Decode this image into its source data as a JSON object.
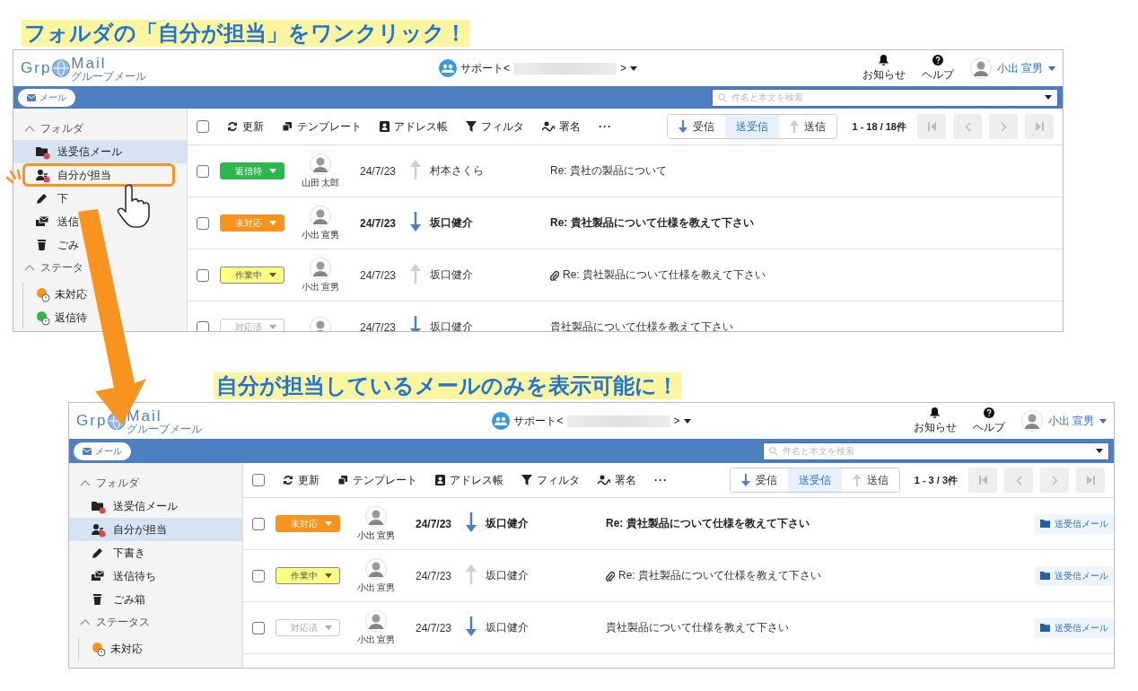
{
  "panels": [
    {
      "caption": "フォルダの「自分が担当」をワンクリック！",
      "screen": {
        "logo": {
          "word_1": "Grp",
          "word_2": "Mail",
          "tagline": "グループメール"
        },
        "account": {
          "prefix": "サポート<",
          "suffix": ">"
        },
        "header_actions": [
          {
            "label": "お知らせ",
            "kind": "bell"
          },
          {
            "label": "ヘルプ",
            "kind": "help"
          }
        ],
        "user": {
          "name": "小出 宣男"
        },
        "app_tab": {
          "label": "メール"
        },
        "search": {
          "placeholder": "件名と本文を検索"
        },
        "select_all": {
          "checked": false
        },
        "toolbar": [
          {
            "label": "更新",
            "kind": "refresh"
          },
          {
            "label": "テンプレート",
            "kind": "template"
          },
          {
            "label": "アドレス帳",
            "kind": "contacts"
          },
          {
            "label": "フィルタ",
            "kind": "filter"
          },
          {
            "label": "署名",
            "kind": "signature"
          },
          {
            "label": "···",
            "kind": "more"
          }
        ],
        "direction_filter": [
          {
            "label": "受信",
            "kind": "in",
            "selected": false
          },
          {
            "label": "送受信",
            "kind": "both",
            "selected": true
          },
          {
            "label": "送信",
            "kind": "out",
            "selected": false
          }
        ],
        "page_count": "1 - 18 / 18件",
        "sidebar": {
          "folders_header": "フォルダ",
          "folders": [
            {
              "label": "送受信メール",
              "kind": "folder",
              "alert": true,
              "selected": true,
              "highlighted": false
            },
            {
              "label": "自分が担当",
              "kind": "person",
              "alert": true,
              "selected": false,
              "highlighted": true
            },
            {
              "label": "下",
              "kind": "pencil",
              "alert": false,
              "selected": false,
              "highlighted": false
            },
            {
              "label": "送信",
              "kind": "outbox",
              "alert": false,
              "selected": false,
              "highlighted": false
            },
            {
              "label": "ごみ",
              "kind": "trash",
              "alert": false,
              "selected": false,
              "highlighted": false
            }
          ],
          "status_header": "ステータ",
          "statuses": [
            {
              "label": "未対応",
              "color": "#f7931e"
            },
            {
              "label": "返信待",
              "color": "#2db84d"
            }
          ]
        },
        "rows": [
          {
            "checked": false,
            "status": {
              "label": "返信待",
              "color": "#2db84d"
            },
            "assignee": "山田 太郎",
            "date": "24/7/23",
            "incoming": false,
            "sender": "村本さくら",
            "subject": "Re: 貴社の製品について",
            "unread": false,
            "attachment": false
          },
          {
            "checked": false,
            "status": {
              "label": "未対応",
              "color": "#f7931e"
            },
            "assignee": "小出 宣男",
            "date": "24/7/23",
            "incoming": true,
            "sender": "坂口健介",
            "subject": "Re: 貴社製品について仕様を教えて下さい",
            "unread": true,
            "attachment": false
          },
          {
            "checked": false,
            "status": {
              "label": "作業中",
              "color": "#ffff80"
            },
            "assignee": "小出 宣男",
            "date": "24/7/23",
            "incoming": false,
            "sender": "坂口健介",
            "subject": "Re: 貴社製品について仕様を教えて下さい",
            "unread": false,
            "attachment": true
          },
          {
            "checked": false,
            "status": {
              "label": "対応済",
              "color": "#ffffff"
            },
            "date": "24/7/23",
            "incoming": true,
            "sender": "坂口健介",
            "subject": "貴社製品について仕様を教えて下さい",
            "unread": false,
            "attachment": false
          }
        ]
      }
    },
    {
      "caption": "自分が担当しているメールのみを表示可能に！",
      "screen": {
        "logo": {
          "word_1": "Grp",
          "word_2": "Mail",
          "tagline": "グループメール"
        },
        "account": {
          "prefix": "サポート<",
          "suffix": ">"
        },
        "header_actions": [
          {
            "label": "お知らせ",
            "kind": "bell"
          },
          {
            "label": "ヘルプ",
            "kind": "help"
          }
        ],
        "user": {
          "name": "小出 宣男"
        },
        "app_tab": {
          "label": "メール"
        },
        "search": {
          "placeholder": "件名と本文を検索"
        },
        "select_all": {
          "checked": false
        },
        "toolbar": [
          {
            "label": "更新",
            "kind": "refresh"
          },
          {
            "label": "テンプレート",
            "kind": "template"
          },
          {
            "label": "アドレス帳",
            "kind": "contacts"
          },
          {
            "label": "フィルタ",
            "kind": "filter"
          },
          {
            "label": "署名",
            "kind": "signature"
          },
          {
            "label": "···",
            "kind": "more"
          }
        ],
        "direction_filter": [
          {
            "label": "受信",
            "kind": "in",
            "selected": false
          },
          {
            "label": "送受信",
            "kind": "both",
            "selected": true
          },
          {
            "label": "送信",
            "kind": "out",
            "selected": false
          }
        ],
        "page_count": "1 - 3 / 3件",
        "sidebar": {
          "folders_header": "フォルダ",
          "folders": [
            {
              "label": "送受信メール",
              "kind": "folder",
              "alert": true,
              "selected": false,
              "highlighted": false
            },
            {
              "label": "自分が担当",
              "kind": "person",
              "alert": true,
              "selected": true,
              "highlighted": false
            },
            {
              "label": "下書き",
              "kind": "pencil",
              "alert": false,
              "selected": false,
              "highlighted": false
            },
            {
              "label": "送信待ち",
              "kind": "outbox",
              "alert": false,
              "selected": false,
              "highlighted": false
            },
            {
              "label": "ごみ箱",
              "kind": "trash",
              "alert": false,
              "selected": false,
              "highlighted": false
            }
          ],
          "status_header": "ステータス",
          "statuses": [
            {
              "label": "未対応",
              "color": "#f7931e"
            }
          ]
        },
        "rows": [
          {
            "checked": false,
            "status": {
              "label": "未対応",
              "color": "#f7931e"
            },
            "assignee": "小出 宣男",
            "date": "24/7/23",
            "incoming": true,
            "sender": "坂口健介",
            "subject": "Re: 貴社製品について仕様を教えて下さい",
            "unread": true,
            "attachment": false,
            "folder": "送受信メール"
          },
          {
            "checked": false,
            "status": {
              "label": "作業中",
              "color": "#ffff80"
            },
            "assignee": "小出 宣男",
            "date": "24/7/23",
            "incoming": false,
            "sender": "坂口健介",
            "subject": "Re: 貴社製品について仕様を教えて下さい",
            "unread": false,
            "attachment": true,
            "folder": "送受信メール"
          },
          {
            "checked": false,
            "status": {
              "label": "対応済",
              "color": "#ffffff"
            },
            "assignee": "小出 宣男",
            "date": "24/7/23",
            "incoming": true,
            "sender": "坂口健介",
            "subject": "貴社製品について仕様を教えて下さい",
            "unread": false,
            "attachment": false,
            "folder": "送受信メール"
          }
        ]
      }
    }
  ]
}
